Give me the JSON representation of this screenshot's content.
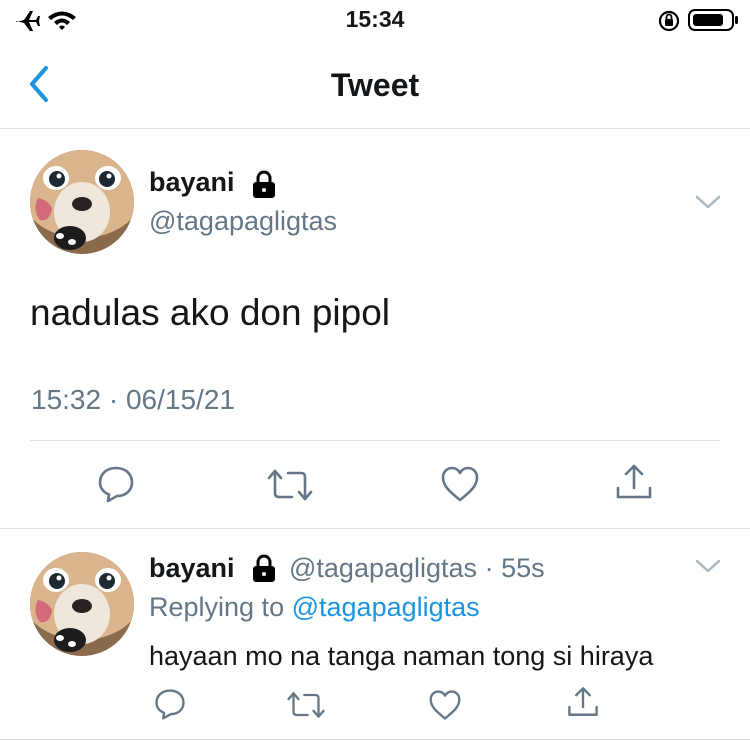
{
  "status_bar": {
    "time": "15:34",
    "icons": [
      "airplane-icon",
      "wifi-icon",
      "orientation-lock-icon",
      "battery-icon"
    ]
  },
  "nav": {
    "title": "Tweet",
    "back_icon": "chevron-left-icon"
  },
  "colors": {
    "accent": "#1b95e0",
    "secondary_text": "#657786",
    "primary_text": "#14171a",
    "divider": "#dfe3e6"
  },
  "main_tweet": {
    "name": "bayani",
    "handle": "@tagapagligtas",
    "text": "nadulas ako don pipol",
    "time": "15:32",
    "separator": "·",
    "date": "06/15/21",
    "actions": [
      "reply-icon",
      "retweet-icon",
      "like-icon",
      "share-icon"
    ]
  },
  "reply_tweet": {
    "name": "bayani",
    "handle": "@tagapagligtas",
    "separator": "·",
    "age": "55s",
    "replying_label": "Replying to",
    "replying_handle": "@tagapagligtas",
    "text": "hayaan mo na tanga naman tong si hiraya",
    "actions": [
      "reply-icon",
      "retweet-icon",
      "like-icon",
      "share-icon"
    ]
  }
}
